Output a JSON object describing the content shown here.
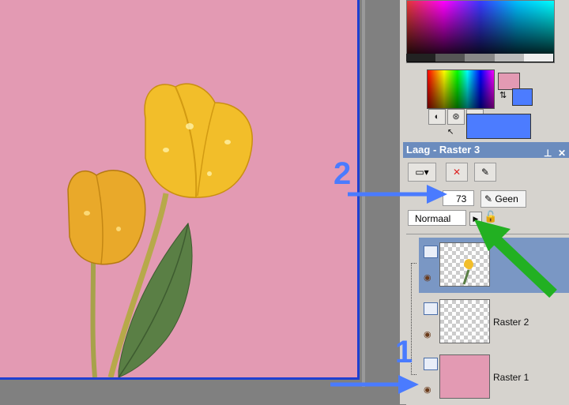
{
  "layer_palette": {
    "title": "Laag - Raster 3",
    "pin_icon": "pin-icon",
    "close_icon": "close-icon",
    "opacity_value": "73",
    "mask_label": "Geen",
    "blend_mode": "Normaal",
    "layers": [
      {
        "name": "Raster 3",
        "selected": true,
        "thumb": "tulip-thumbnail",
        "name_visible_fragment": "3"
      },
      {
        "name": "Raster 2",
        "selected": false,
        "thumb": "transparent"
      },
      {
        "name": "Raster 1",
        "selected": false,
        "thumb": "pink-fill"
      }
    ]
  },
  "annotations": {
    "label_1": "1",
    "label_2": "2"
  },
  "colors": {
    "canvas_bg": "#e39ab3",
    "canvas_border": "#1f3fd0",
    "foreground": "#e39ab3",
    "background": "#4c7cff",
    "panel_title_bg": "#6b8cbe",
    "annotation_blue": "#4a7bff",
    "annotation_green": "#22b022"
  }
}
